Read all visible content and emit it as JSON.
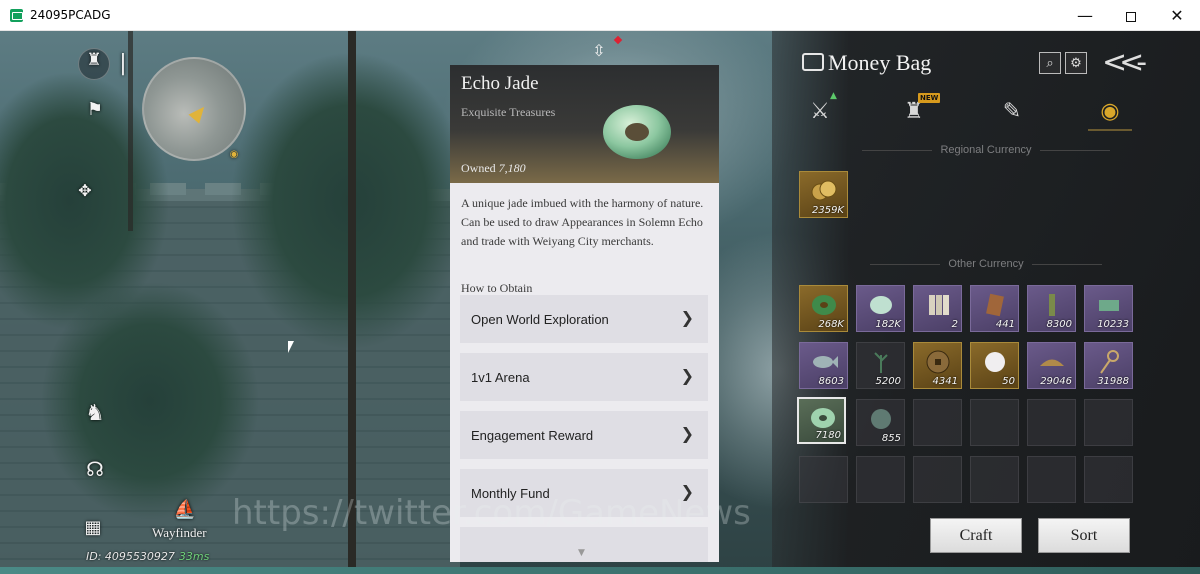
{
  "window": {
    "title": "24095PCADG",
    "minimize": "—",
    "close": "✕"
  },
  "hud": {
    "wayfinder_label": "Wayfinder",
    "player_id": "ID: 4095530927",
    "ping": "33ms",
    "watermark": "https://twitter.com/GameNews"
  },
  "money_bag": {
    "title": "Money Bag",
    "tabs": [
      {
        "icon": "crossed-swords-icon",
        "glyph": "⚔",
        "badge": "▲",
        "active": false
      },
      {
        "icon": "pouch-icon",
        "glyph": "♜",
        "badge": "NEW",
        "active": false
      },
      {
        "icon": "scroll-icon",
        "glyph": "✎",
        "badge": "",
        "active": false
      },
      {
        "icon": "currency-icon",
        "glyph": "◉",
        "badge": "",
        "active": true
      }
    ],
    "regional_label": "Regional Currency",
    "regional_items": [
      {
        "name": "coins-icon",
        "count": "2359K"
      }
    ],
    "other_label": "Other Currency",
    "other_items": [
      {
        "name": "green-jade-disc-icon",
        "count": "268K"
      },
      {
        "name": "pale-jade-icon",
        "count": "182K"
      },
      {
        "name": "paper-notes-icon",
        "count": "2"
      },
      {
        "name": "bronze-token-icon",
        "count": "441"
      },
      {
        "name": "tally-stick-icon",
        "count": "8300"
      },
      {
        "name": "green-note-icon",
        "count": "10233"
      },
      {
        "name": "fish-icon",
        "count": "8603"
      },
      {
        "name": "herb-icon",
        "count": "5200"
      },
      {
        "name": "copper-coin-icon",
        "count": "4341"
      },
      {
        "name": "pearl-icon",
        "count": "50"
      },
      {
        "name": "ingot-icon",
        "count": "29046"
      },
      {
        "name": "key-icon",
        "count": "31988"
      },
      {
        "name": "echo-jade-icon",
        "count": "7180"
      },
      {
        "name": "stone-disc-icon",
        "count": "855"
      }
    ],
    "craft_label": "Craft",
    "sort_label": "Sort"
  },
  "detail": {
    "title": "Echo Jade",
    "subtitle": "Exquisite Treasures",
    "owned_label": "Owned",
    "owned_value": "7,180",
    "description": "A unique jade imbued with the harmony of nature. Can be used to draw Appearances in Solemn Echo and trade with Weiyang City merchants.",
    "how_to_obtain": "How to Obtain",
    "sources": [
      "Open World Exploration",
      "1v1 Arena",
      "Engagement Reward",
      "Monthly Fund"
    ]
  },
  "colors": {
    "accent_gold": "#d9a72a",
    "item_purple": "#6a5a8a",
    "panel_dark": "#18191b"
  }
}
